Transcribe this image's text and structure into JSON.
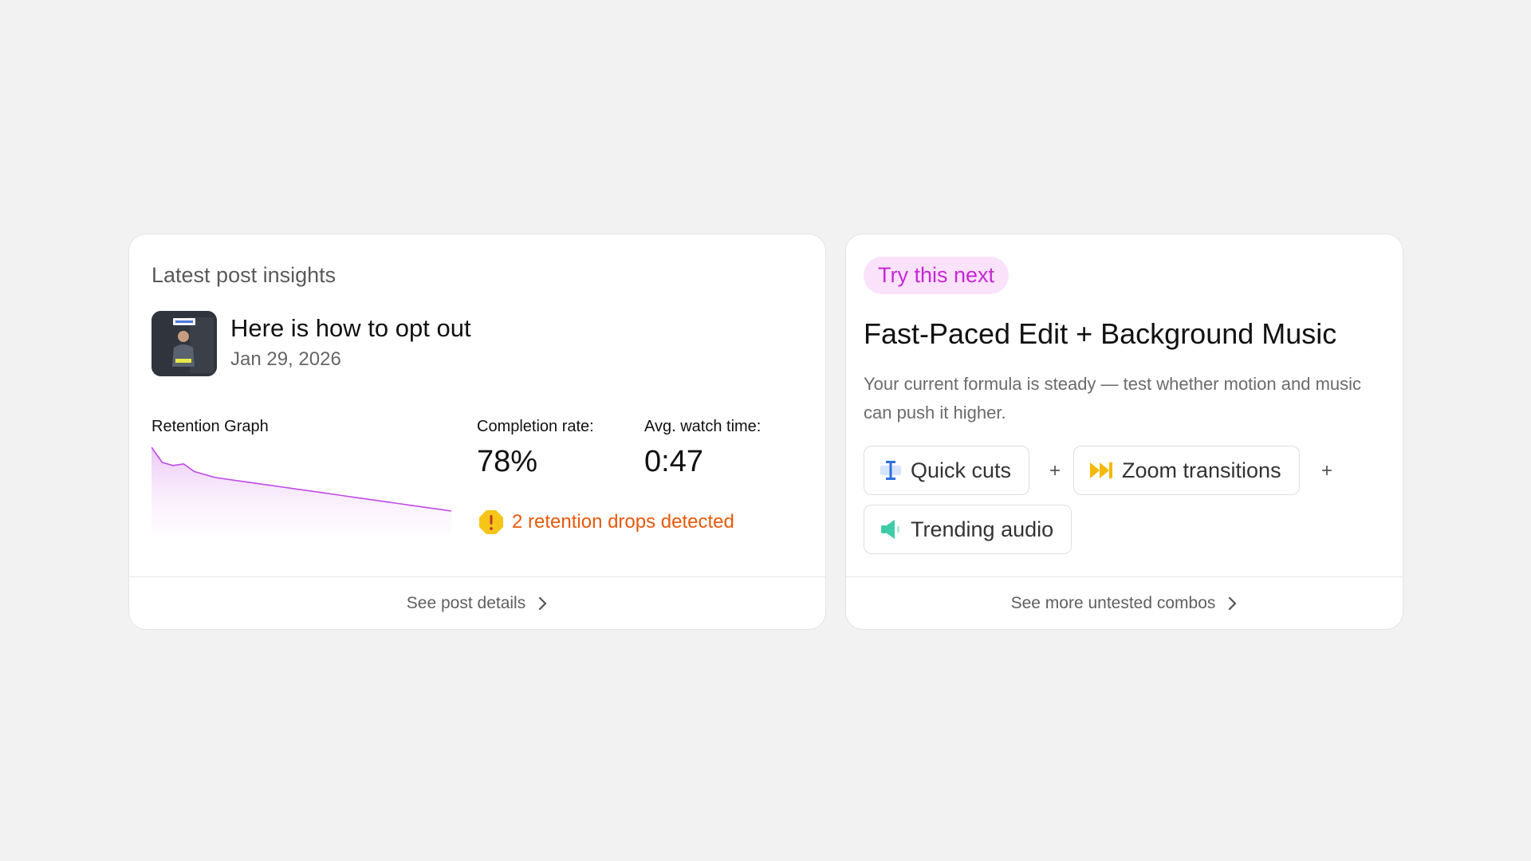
{
  "insights_card": {
    "title": "Latest post insights",
    "post": {
      "title": "Here is how to opt out",
      "date": "Jan 29, 2026",
      "thumbnail_icon": "video-thumbnail"
    },
    "retention": {
      "label": "Retention Graph",
      "curve": [
        100,
        90,
        88,
        89,
        84,
        82,
        80,
        79,
        78,
        77,
        76,
        75,
        74,
        73,
        72,
        71,
        70,
        69,
        68,
        67,
        66,
        65,
        64,
        63,
        62,
        61,
        60,
        59,
        58
      ],
      "line_color": "#c04ae6"
    },
    "stats": {
      "completion_label": "Completion rate:",
      "completion_value": "78%",
      "watch_label": "Avg. watch time:",
      "watch_value": "0:47"
    },
    "warning": {
      "text": "2 retention drops detected",
      "icon": "warning-octagon-icon",
      "color": "#e8590c"
    },
    "footer_link": "See post details"
  },
  "next_card": {
    "badge": "Try this next",
    "headline": "Fast-Paced Edit + Background Music",
    "description": "Your current formula is steady — test whether motion and music can push it higher.",
    "chips": [
      {
        "label": "Quick cuts",
        "icon": "text-cursor-icon"
      },
      {
        "label": "Zoom transitions",
        "icon": "fast-forward-icon"
      },
      {
        "label": "Trending audio",
        "icon": "speaker-icon"
      }
    ],
    "separator": "+",
    "footer_link": "See more untested combos"
  },
  "colors": {
    "accent_pink": "#c727d6",
    "badge_bg": "#fbe2fb",
    "warning": "#e8590c"
  }
}
